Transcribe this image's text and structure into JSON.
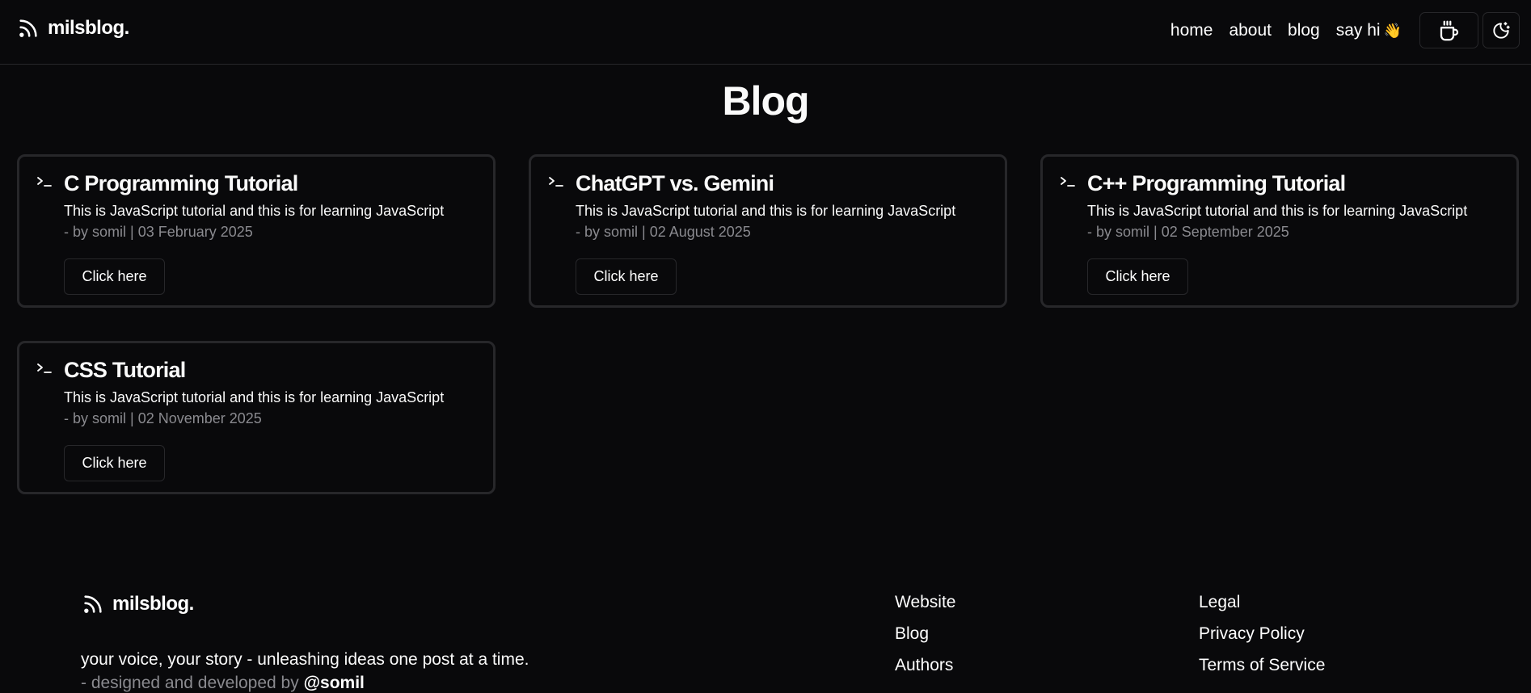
{
  "header": {
    "brand": "milsblog.",
    "nav": [
      {
        "label": "home"
      },
      {
        "label": "about"
      },
      {
        "label": "blog"
      },
      {
        "label": "say hi"
      }
    ],
    "wave_emoji": "👋",
    "icons": {
      "brand": "rss-icon",
      "coffee": "coffee-cup-icon",
      "theme": "moon-stars-icon"
    }
  },
  "page": {
    "title": "Blog"
  },
  "posts": [
    {
      "title": "C Programming Tutorial",
      "description": "This is JavaScript tutorial and this is for learning JavaScript",
      "meta": "- by somil | 03 February 2025",
      "button": "Click here"
    },
    {
      "title": "ChatGPT vs. Gemini",
      "description": "This is JavaScript tutorial and this is for learning JavaScript",
      "meta": "- by somil | 02 August 2025",
      "button": "Click here"
    },
    {
      "title": "C++ Programming Tutorial",
      "description": "This is JavaScript tutorial and this is for learning JavaScript",
      "meta": "- by somil | 02 September 2025",
      "button": "Click here"
    },
    {
      "title": "CSS Tutorial",
      "description": "This is JavaScript tutorial and this is for learning JavaScript",
      "meta": "- by somil | 02 November 2025",
      "button": "Click here"
    }
  ],
  "footer": {
    "brand": "milsblog.",
    "tagline": "your voice, your story - unleashing ideas one post at a time.",
    "credit_prefix": "- designed and developed by",
    "credit_handle": "@somil",
    "columns": [
      {
        "links": [
          "Website",
          "Blog",
          "Authors"
        ]
      },
      {
        "links": [
          "Legal",
          "Privacy Policy",
          "Terms of Service"
        ]
      }
    ]
  },
  "colors": {
    "background": "#09090b",
    "border": "#27272a",
    "text": "#fafafa",
    "muted": "#8a8a8f"
  }
}
